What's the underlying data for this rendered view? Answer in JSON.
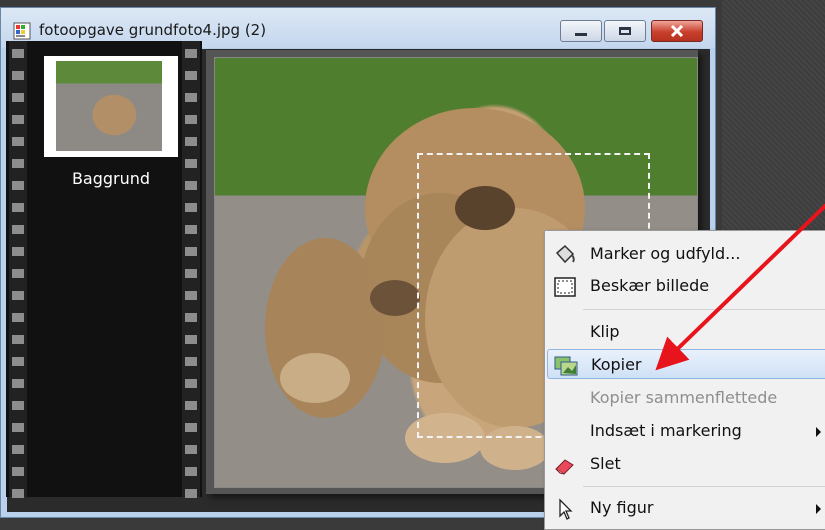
{
  "window": {
    "title": "fotoopgave grundfoto4.jpg (2)",
    "icons": [
      "image-file-icon"
    ],
    "buttons": {
      "minimize": "minimize-icon",
      "maximize": "maximize-icon",
      "close": "close-icon"
    }
  },
  "layers": {
    "items": [
      {
        "label": "Baggrund",
        "thumbnail": "lion-cub-thumbnail"
      }
    ]
  },
  "context_menu": {
    "items": [
      {
        "label": "Marker og udfyld...",
        "icon": "paint-bucket-icon",
        "disabled": false
      },
      {
        "label": "Beskær billede",
        "icon": "crop-icon",
        "disabled": false
      },
      {
        "label": "Klip",
        "icon": "",
        "disabled": false
      },
      {
        "label": "Kopier",
        "icon": "copy-image-icon",
        "disabled": false,
        "highlighted": true
      },
      {
        "label": "Kopier sammenflettede",
        "icon": "",
        "disabled": true
      },
      {
        "label": "Indsæt i markering",
        "icon": "",
        "disabled": false,
        "submenu": true
      },
      {
        "label": "Slet",
        "icon": "eraser-icon",
        "disabled": false
      },
      {
        "label": "Ny figur",
        "icon": "pointer-icon",
        "disabled": false,
        "submenu": true
      }
    ]
  },
  "colors": {
    "highlight": "#cfe1f6",
    "annotation_arrow": "#e8141b",
    "close_button": "#c8402c"
  }
}
